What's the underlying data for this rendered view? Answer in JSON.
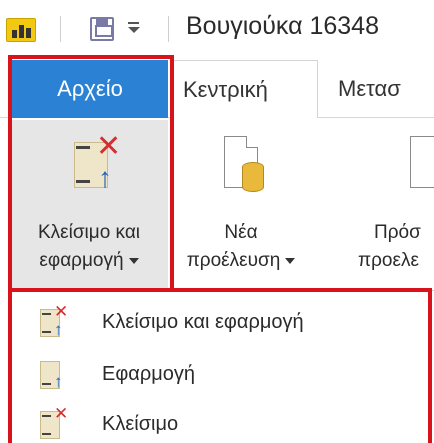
{
  "titlebar": {
    "app_icon": "power-bi-icon",
    "save_icon": "save-icon",
    "quick_access_icon": "customize-quick-access-icon",
    "title": "Βουγιούκα 16348"
  },
  "tabs": {
    "file": "Αρχείο",
    "home": "Κεντρική",
    "transform": "Μετασ"
  },
  "ribbon": {
    "close_apply": {
      "line1": "Κλείσιμο και",
      "line2": "εφαρμογή",
      "icon": "close-apply-icon"
    },
    "new_source": {
      "line1": "Νέα",
      "line2": "προέλευση",
      "icon": "new-source-icon"
    },
    "recent_sources": {
      "line1": "Πρόσ",
      "line2": "προελε",
      "icon": "recent-sources-icon"
    }
  },
  "menu": {
    "items": [
      {
        "label": "Κλείσιμο και εφαρμογή",
        "icon": "close-apply-icon"
      },
      {
        "label": "Εφαρμογή",
        "icon": "apply-icon"
      },
      {
        "label": "Κλείσιμο",
        "icon": "close-icon"
      }
    ]
  },
  "colors": {
    "file_tab": "#2b82d5",
    "highlight": "#d8131c",
    "close_x": "#d32f2f",
    "apply_arrow": "#1f63b8"
  }
}
